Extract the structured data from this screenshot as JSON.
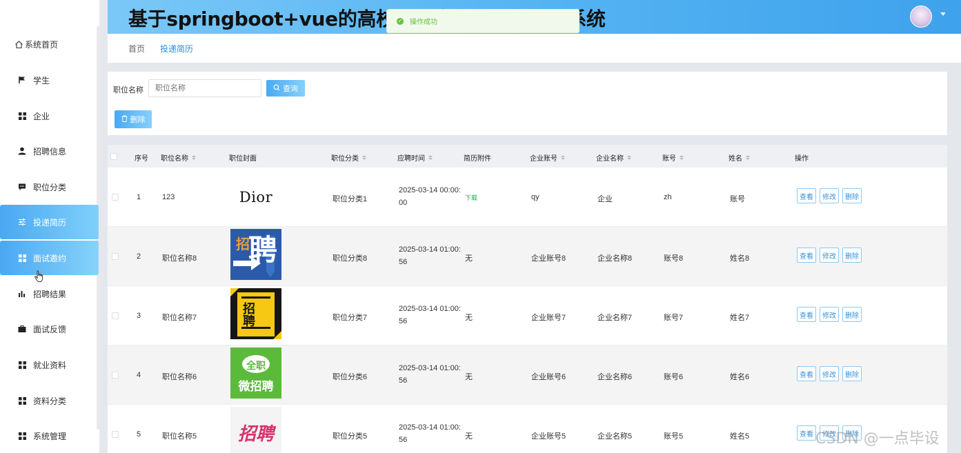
{
  "header": {
    "title": "基于springboot+vue的高校毕业生就业服务管理系统"
  },
  "toast": {
    "message": "操作成功"
  },
  "sidebar": {
    "items": [
      {
        "label": "系统首页"
      },
      {
        "label": "学生"
      },
      {
        "label": "企业"
      },
      {
        "label": "招聘信息"
      },
      {
        "label": "职位分类"
      },
      {
        "label": "投递简历"
      },
      {
        "label": "面试邀约"
      },
      {
        "label": "招聘结果"
      },
      {
        "label": "面试反馈"
      },
      {
        "label": "就业资料"
      },
      {
        "label": "资料分类"
      },
      {
        "label": "系统管理"
      }
    ]
  },
  "breadcrumb": {
    "home": "首页",
    "current": "投递简历"
  },
  "search": {
    "label": "职位名称",
    "placeholder": "职位名称",
    "query_button": "查询",
    "delete_button": "删除"
  },
  "table": {
    "columns": [
      "序号",
      "职位名称",
      "职位封面",
      "职位分类",
      "应聘时间",
      "简历附件",
      "企业账号",
      "企业名称",
      "账号",
      "姓名",
      "操作"
    ],
    "rows": [
      {
        "no": "1",
        "name": "123",
        "cover": "Dior",
        "category": "职位分类1",
        "time": "2025-03-14 00:00:00",
        "attachment": "下载",
        "company_account": "qy",
        "company_name": "企业",
        "account": "zh",
        "person": "账号"
      },
      {
        "no": "2",
        "name": "职位名称8",
        "cover": "招聘",
        "category": "职位分类8",
        "time": "2025-03-14 01:00:56",
        "attachment": "无",
        "company_account": "企业账号8",
        "company_name": "企业名称8",
        "account": "账号8",
        "person": "姓名8"
      },
      {
        "no": "3",
        "name": "职位名称7",
        "cover": "招聘",
        "category": "职位分类7",
        "time": "2025-03-14 01:00:56",
        "attachment": "无",
        "company_account": "企业账号7",
        "company_name": "企业名称7",
        "account": "账号7",
        "person": "姓名7"
      },
      {
        "no": "4",
        "name": "职位名称6",
        "cover": "全职微招聘",
        "category": "职位分类6",
        "time": "2025-03-14 01:00:56",
        "attachment": "无",
        "company_account": "企业账号6",
        "company_name": "企业名称6",
        "account": "账号6",
        "person": "姓名6"
      },
      {
        "no": "5",
        "name": "职位名称5",
        "cover": "招聘",
        "category": "职位分类5",
        "time": "2025-03-14 01:00:56",
        "attachment": "无",
        "company_account": "企业账号5",
        "company_name": "企业名称5",
        "account": "账号5",
        "person": "姓名5"
      }
    ],
    "actions": {
      "view": "查看",
      "edit": "修改",
      "delete": "删除"
    }
  },
  "cover_art": {
    "dior": "Dior",
    "row2_top": "招",
    "row2_main": "聘",
    "row3_main": "招聘",
    "row4_top": "全职",
    "row4_bottom": "微招聘",
    "row5": "招聘"
  },
  "watermark": "CSDN @一点毕设",
  "colors": {
    "accent": "#49a9f3",
    "success": "#67c23a",
    "download": "#1bae55"
  }
}
